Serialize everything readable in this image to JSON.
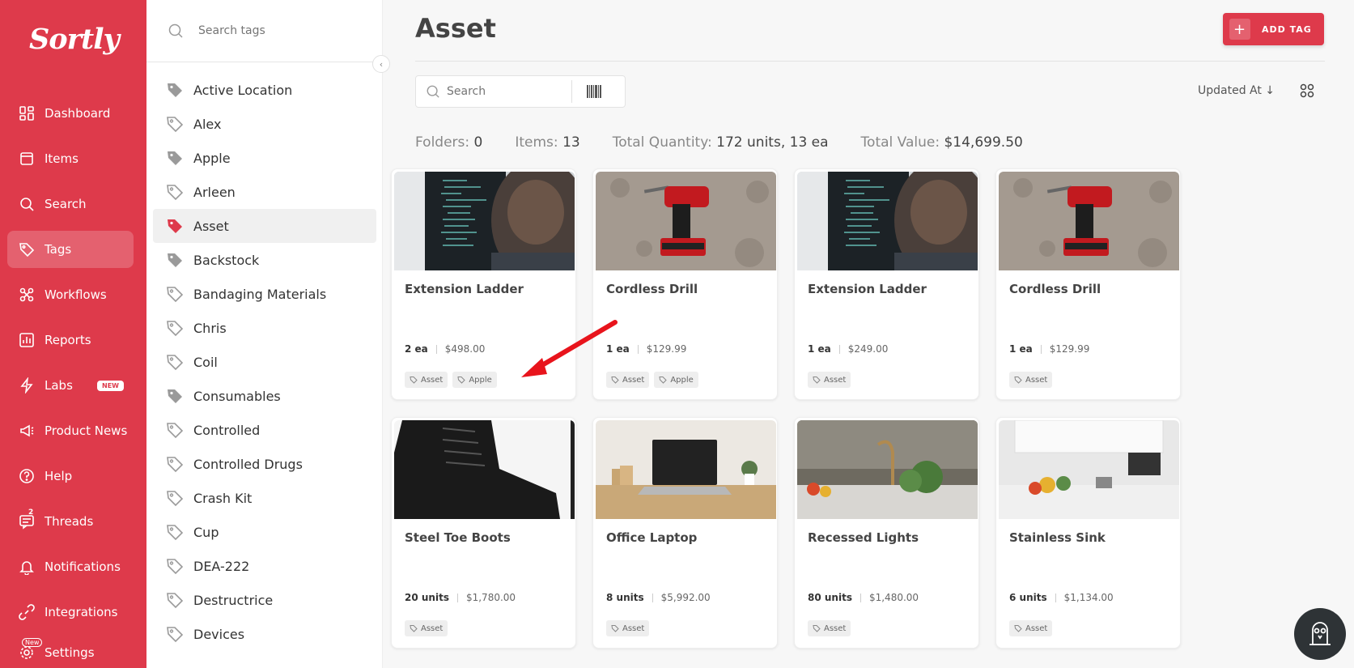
{
  "brand": {
    "logo": "Sortly",
    "accent": "#de3a4b"
  },
  "nav": {
    "items": [
      {
        "label": "Dashboard",
        "icon": "dashboard-icon"
      },
      {
        "label": "Items",
        "icon": "items-icon"
      },
      {
        "label": "Search",
        "icon": "search-icon"
      },
      {
        "label": "Tags",
        "icon": "tag-icon"
      },
      {
        "label": "Workflows",
        "icon": "workflows-icon"
      },
      {
        "label": "Reports",
        "icon": "reports-icon"
      },
      {
        "label": "Labs",
        "icon": "bolt-icon",
        "badge": "NEW"
      },
      {
        "label": "Product News",
        "icon": "megaphone-icon"
      },
      {
        "label": "Help",
        "icon": "help-icon"
      },
      {
        "label": "Threads",
        "icon": "threads-icon",
        "count": "2"
      },
      {
        "label": "Notifications",
        "icon": "bell-icon"
      },
      {
        "label": "Integrations",
        "icon": "integrations-icon"
      },
      {
        "label": "Settings",
        "icon": "gear-icon",
        "badge": "New"
      }
    ]
  },
  "tags_panel": {
    "search_placeholder": "Search tags",
    "tags": [
      {
        "label": "Active Location",
        "filled": true
      },
      {
        "label": "Alex",
        "filled": false
      },
      {
        "label": "Apple",
        "filled": true
      },
      {
        "label": "Arleen",
        "filled": false
      },
      {
        "label": "Asset",
        "filled": true,
        "active": true
      },
      {
        "label": "Backstock",
        "filled": true
      },
      {
        "label": "Bandaging Materials",
        "filled": false
      },
      {
        "label": "Chris",
        "filled": false
      },
      {
        "label": "Coil",
        "filled": false
      },
      {
        "label": "Consumables",
        "filled": true
      },
      {
        "label": "Controlled",
        "filled": false
      },
      {
        "label": "Controlled Drugs",
        "filled": false
      },
      {
        "label": "Crash Kit",
        "filled": false
      },
      {
        "label": "Cup",
        "filled": false
      },
      {
        "label": "DEA-222",
        "filled": false
      },
      {
        "label": "Destructrice",
        "filled": false
      },
      {
        "label": "Devices",
        "filled": false
      }
    ]
  },
  "main": {
    "title": "Asset",
    "add_tag_label": "ADD TAG",
    "search_placeholder": "Search",
    "sort_label": "Updated At",
    "stats": {
      "folders_label": "Folders:",
      "folders_value": "0",
      "items_label": "Items:",
      "items_value": "13",
      "quantity_label": "Total Quantity:",
      "quantity_value": "172 units, 13 ea",
      "value_label": "Total Value:",
      "value_value": "$14,699.50"
    },
    "cards": [
      {
        "title": "Extension Ladder",
        "qty": "2 ea",
        "price": "$498.00",
        "tags": [
          "Asset",
          "Apple"
        ],
        "image": "monitor-code"
      },
      {
        "title": "Cordless Drill",
        "qty": "1 ea",
        "price": "$129.99",
        "tags": [
          "Asset",
          "Apple"
        ],
        "image": "drill"
      },
      {
        "title": "Extension Ladder",
        "qty": "1 ea",
        "price": "$249.00",
        "tags": [
          "Asset"
        ],
        "image": "monitor-code"
      },
      {
        "title": "Cordless Drill",
        "qty": "1 ea",
        "price": "$129.99",
        "tags": [
          "Asset"
        ],
        "image": "drill"
      },
      {
        "title": "Steel Toe Boots",
        "qty": "20 units",
        "price": "$1,780.00",
        "tags": [
          "Asset"
        ],
        "image": "boot"
      },
      {
        "title": "Office Laptop",
        "qty": "8 units",
        "price": "$5,992.00",
        "tags": [
          "Asset"
        ],
        "image": "laptop"
      },
      {
        "title": "Recessed Lights",
        "qty": "80 units",
        "price": "$1,480.00",
        "tags": [
          "Asset"
        ],
        "image": "kitchen-sink"
      },
      {
        "title": "Stainless Sink",
        "qty": "6 units",
        "price": "$1,134.00",
        "tags": [
          "Asset"
        ],
        "image": "kitchen"
      }
    ]
  }
}
